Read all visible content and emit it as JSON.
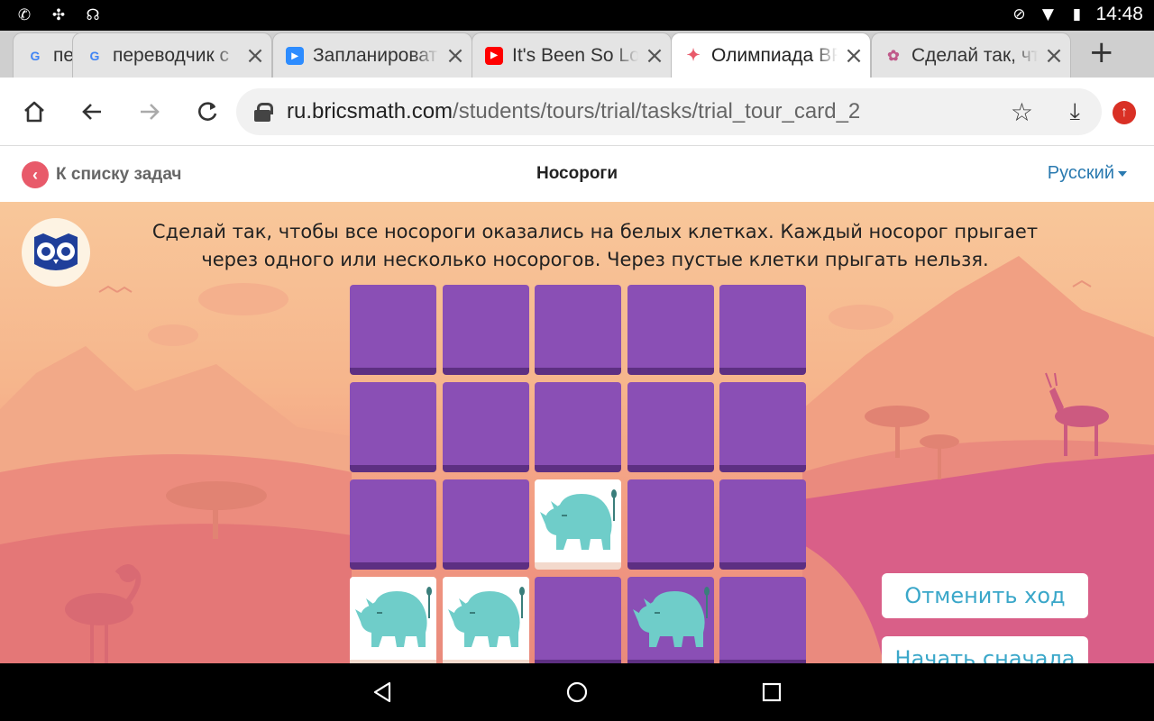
{
  "status_bar": {
    "left_icons": [
      "phone-icon",
      "sync-icon",
      "headset-icon"
    ],
    "right_icons": [
      "dnd-icon",
      "wifi-icon",
      "battery-icon"
    ],
    "time": "14:48"
  },
  "tabs": [
    {
      "title": "пе",
      "favicon": "google-icon",
      "active": false
    },
    {
      "title": "переводчик с",
      "favicon": "google-icon",
      "active": false
    },
    {
      "title": "Запланироват",
      "favicon": "zoom-icon",
      "active": false
    },
    {
      "title": "It's Been So Lo",
      "favicon": "youtube-icon",
      "active": false
    },
    {
      "title": "Олимпиада BF",
      "favicon": "bricsmath-icon",
      "active": true
    },
    {
      "title": "Сделай так, чт",
      "favicon": "brain-icon",
      "active": false
    }
  ],
  "toolbar": {
    "url_host": "ru.bricsmath.com",
    "url_path": "/students/tours/trial/tasks/trial_tour_card_2"
  },
  "page_header": {
    "back_label": "К списку задач",
    "title": "Носороги",
    "language": "Русский"
  },
  "task": {
    "instructions": "Сделай так, чтобы все носороги оказались на белых клетках. Каждый носорог прыгает через одного или несколько носорогов. Через пустые клетки прыгать нельзя.",
    "grid": [
      [
        "purple",
        "purple",
        "purple",
        "purple",
        "purple"
      ],
      [
        "purple",
        "purple",
        "purple",
        "purple",
        "purple"
      ],
      [
        "purple",
        "purple",
        "white-rhino",
        "purple",
        "purple"
      ],
      [
        "white-rhino",
        "white-rhino",
        "purple",
        "purple-rhino",
        "purple"
      ]
    ]
  },
  "actions": {
    "undo_label": "Отменить ход",
    "restart_label": "Начать сначала"
  },
  "colors": {
    "cell_purple": "#8a4fb5",
    "cell_white": "#ffffff",
    "rhino": "#6fcdc9",
    "button_text": "#3aa7c9",
    "language_link": "#2a7ab0"
  }
}
